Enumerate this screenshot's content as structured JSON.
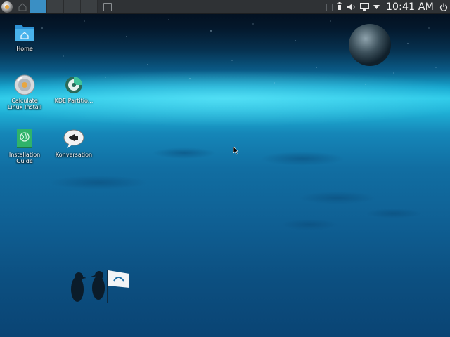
{
  "panel": {
    "launcher_icon": "calculate-linux-logo-icon",
    "pager_desktops": 4,
    "active_desktop": 1,
    "clock": "10:41 AM",
    "tray_icons": [
      "clipboard-icon",
      "battery-icon",
      "volume-icon",
      "display-icon",
      "expand-arrow-icon",
      "power-icon"
    ]
  },
  "desktop": {
    "icons": [
      {
        "label": "Home",
        "icon": "folder-home-icon"
      },
      {
        "label": "Calculate Linux Install",
        "icon": "installer-disc-icon"
      },
      {
        "label": "KDE Partitio...",
        "icon": "partition-manager-icon"
      },
      {
        "label": "Installation Guide",
        "icon": "globe-guide-icon"
      },
      {
        "label": "Konversation",
        "icon": "chat-bubble-icon"
      }
    ]
  },
  "colors": {
    "panel_bg": "#2f3235",
    "pager_active": "#3a8fc4",
    "horizon_glow": "#2cc9e8",
    "sky_dark": "#020a16"
  }
}
